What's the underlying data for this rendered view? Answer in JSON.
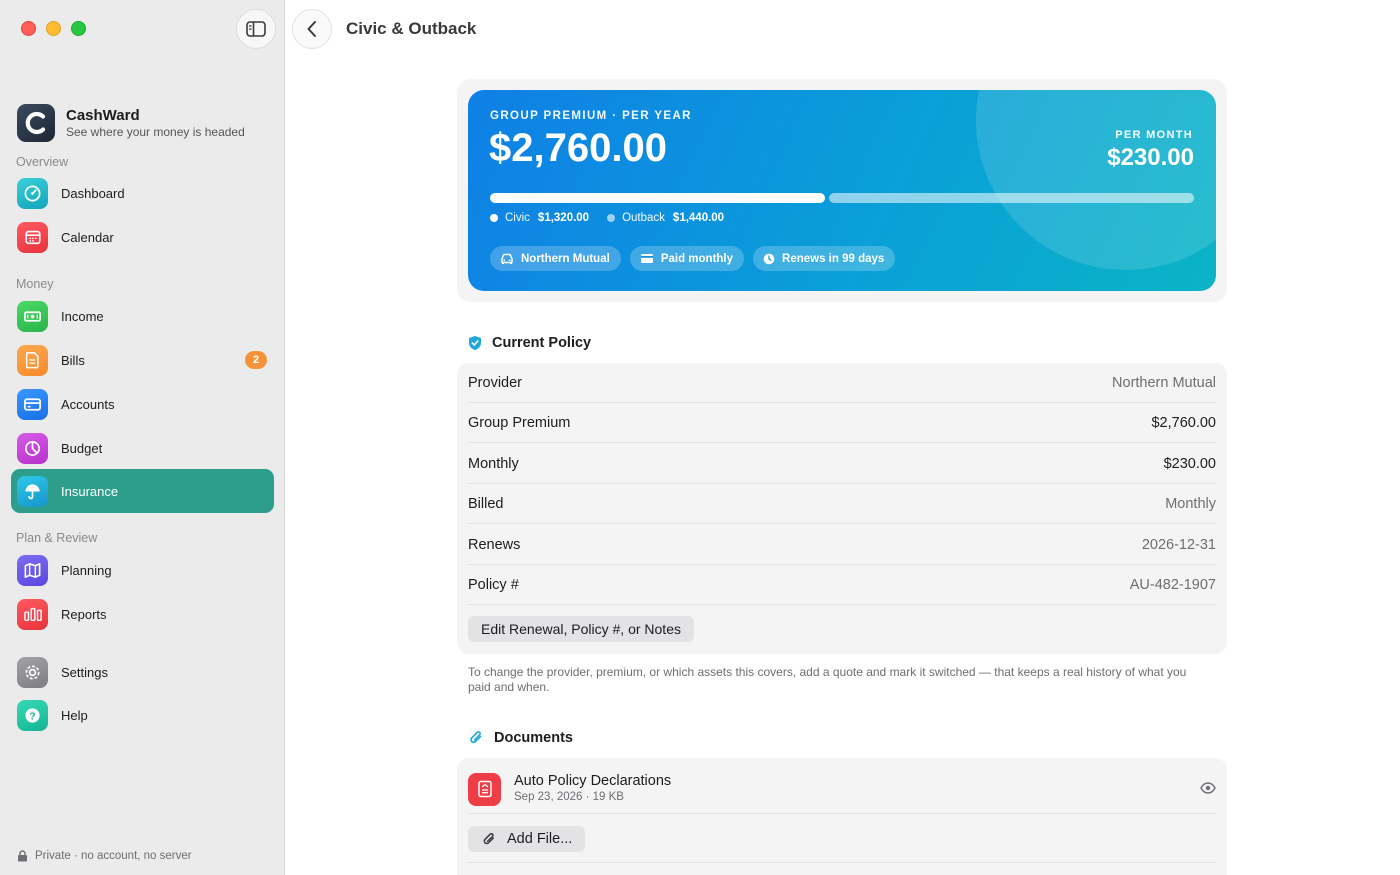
{
  "window": {
    "title": "Civic & Outback"
  },
  "brand": {
    "name": "CashWard",
    "tagline": "See where your money is headed"
  },
  "sidebar": {
    "sections": {
      "overview": "Overview",
      "money": "Money",
      "plan": "Plan & Review"
    },
    "items": [
      {
        "label": "Dashboard",
        "icon": "dashboard-icon",
        "color": "#1fb9c9"
      },
      {
        "label": "Calendar",
        "icon": "calendar-icon",
        "color": "#f0414b"
      },
      {
        "label": "Income",
        "icon": "banknote-icon",
        "color": "#34c759"
      },
      {
        "label": "Bills",
        "icon": "document-icon",
        "color": "#f5923a",
        "badge": "2"
      },
      {
        "label": "Accounts",
        "icon": "credit-card-icon",
        "color": "#1a7ff0"
      },
      {
        "label": "Budget",
        "icon": "pie-chart-icon",
        "color": "#c646d8"
      },
      {
        "label": "Insurance",
        "icon": "umbrella-icon",
        "color": "#1fb0d8",
        "active": true
      },
      {
        "label": "Planning",
        "icon": "map-icon",
        "color": "#6a5ae6"
      },
      {
        "label": "Reports",
        "icon": "bar-chart-icon",
        "color": "#f0414b"
      },
      {
        "label": "Settings",
        "icon": "gear-icon",
        "color": "#8e8e93"
      },
      {
        "label": "Help",
        "icon": "help-icon",
        "color": "#1fc7a6"
      }
    ],
    "footer": "Private · no account, no server"
  },
  "hero": {
    "kicker": "GROUP PREMIUM · PER YEAR",
    "amount": "$2,760.00",
    "per_month_label": "PER MONTH",
    "per_month_value": "$230.00",
    "split": [
      {
        "name": "Civic",
        "value": "$1,320.00",
        "share": 1320
      },
      {
        "name": "Outback",
        "value": "$1,440.00",
        "share": 1440
      }
    ],
    "chips": [
      {
        "label": "Northern Mutual",
        "icon": "car-icon"
      },
      {
        "label": "Paid monthly",
        "icon": "card-icon"
      },
      {
        "label": "Renews in 99 days",
        "icon": "clock-icon"
      }
    ]
  },
  "policy": {
    "title": "Current Policy",
    "rows": [
      {
        "key": "Provider",
        "value": "Northern Mutual"
      },
      {
        "key": "Group Premium",
        "value": "$2,760.00"
      },
      {
        "key": "Monthly",
        "value": "$230.00"
      },
      {
        "key": "Billed",
        "value": "Monthly"
      },
      {
        "key": "Renews",
        "value": "2026-12-31"
      },
      {
        "key": "Policy #",
        "value": "AU-482-1907"
      }
    ],
    "edit_label": "Edit Renewal, Policy #, or Notes",
    "hint": "To change the provider, premium, or which assets this covers, add a quote and mark it switched — that keeps a real history of what you paid and when."
  },
  "documents": {
    "title": "Documents",
    "items": [
      {
        "name": "Auto Policy Declarations",
        "meta": "Sep 23, 2026 · 19 KB"
      }
    ],
    "add_label": "Add File..."
  }
}
